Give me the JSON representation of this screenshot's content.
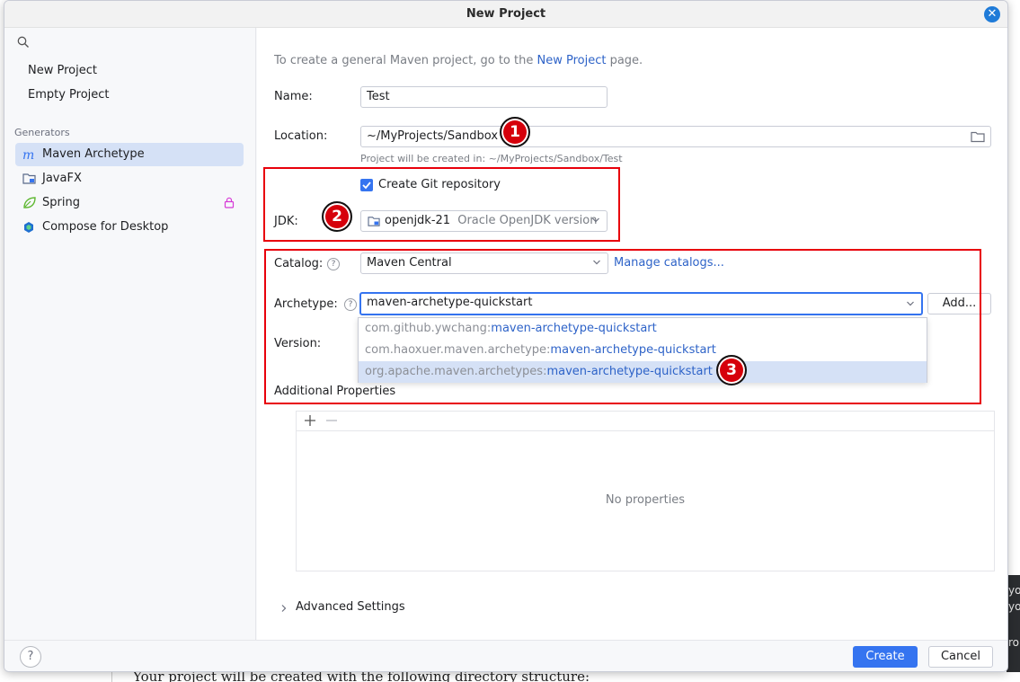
{
  "window": {
    "title": "New Project"
  },
  "sidebar": {
    "search_placeholder": "",
    "top_items": [
      {
        "label": "New Project"
      },
      {
        "label": "Empty Project"
      }
    ],
    "generators_label": "Generators",
    "generators": [
      {
        "label": "Maven Archetype",
        "icon": "maven-icon",
        "selected": true
      },
      {
        "label": "JavaFX",
        "icon": "javafx-icon"
      },
      {
        "label": "Spring",
        "icon": "spring-icon",
        "locked": true
      },
      {
        "label": "Compose for Desktop",
        "icon": "compose-icon"
      }
    ]
  },
  "main": {
    "hint_prefix": "To create a general Maven project, go to the ",
    "hint_link": "New Project",
    "hint_suffix": " page.",
    "name_label": "Name:",
    "name_value": "Test",
    "location_label": "Location:",
    "location_value": "~/MyProjects/Sandbox",
    "location_hint": "Project will be created in: ~/MyProjects/Sandbox/Test",
    "git_label": "Create Git repository",
    "git_checked": true,
    "jdk_label": "JDK:",
    "jdk_name": "openjdk-21",
    "jdk_detail": "Oracle OpenJDK version",
    "catalog_label": "Catalog:",
    "catalog_value": "Maven Central",
    "manage_catalogs": "Manage catalogs...",
    "archetype_label": "Archetype:",
    "archetype_value": "maven-archetype-quickstart",
    "add_button": "Add...",
    "version_label": "Version:",
    "archetype_options": [
      {
        "group": "com.github.ywchang:",
        "artifact": "maven-archetype-quickstart"
      },
      {
        "group": "com.haoxuer.maven.archetype:",
        "artifact": "maven-archetype-quickstart"
      },
      {
        "group": "org.apache.maven.archetypes:",
        "artifact": "maven-archetype-quickstart",
        "selected": true
      }
    ],
    "additional_properties_label": "Additional Properties",
    "no_properties": "No properties",
    "advanced_settings": "Advanced Settings"
  },
  "footer": {
    "help": "?",
    "create": "Create",
    "cancel": "Cancel"
  },
  "annotations": {
    "one": "1",
    "two": "2",
    "three": "3"
  },
  "background": {
    "bottom_text": "Your project will be created with the following directory structure:",
    "right_frag_1": "yo",
    "right_frag_2": "yo",
    "right_frag_3": "ro"
  },
  "colors": {
    "accent": "#3574f0",
    "annotation_red": "#e8000b",
    "link": "#2e63c8"
  }
}
